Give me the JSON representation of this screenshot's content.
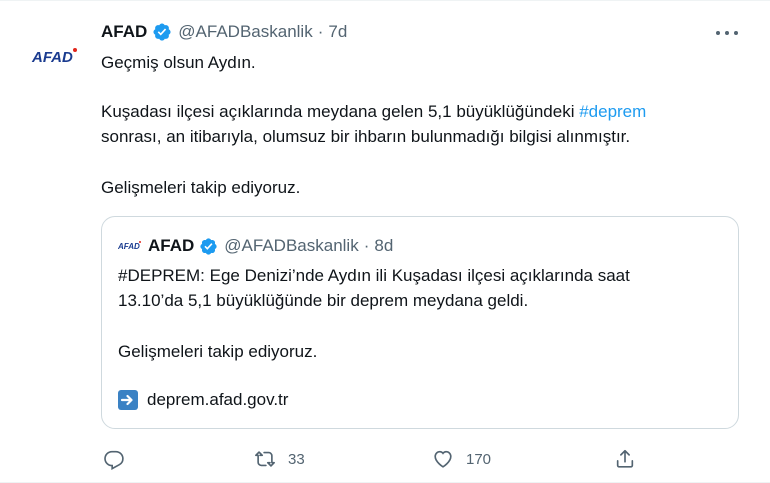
{
  "tweet": {
    "author_name": "AFAD",
    "handle": "@AFADBaskanlik",
    "separator": "·",
    "time": "7d",
    "avatar_logo": "AFAD",
    "lines": {
      "greeting": "Geçmiş olsun Aydın.",
      "line2_prefix": "Kuşadası ilçesi açıklarında meydana gelen 5,1 büyüklüğündeki ",
      "hashtag": "#deprem",
      "line3": "sonrası, an itibarıyla, olumsuz bir ihbarın bulunmadığı bilgisi alınmıştır.",
      "closing": "Gelişmeleri takip ediyoruz."
    }
  },
  "quote": {
    "author_name": "AFAD",
    "handle": "@AFADBaskanlik",
    "separator": "·",
    "time": "8d",
    "lines": {
      "line1": "#DEPREM: Ege Denizi’nde Aydın ili Kuşadası ilçesi açıklarında saat",
      "line2": "13.10’da 5,1 büyüklüğünde bir deprem meydana geldi.",
      "closing": "Gelişmeleri takip ediyoruz."
    },
    "link_text": "deprem.afad.gov.tr",
    "link_icon": "arrow-right-box-icon"
  },
  "actions": {
    "reply": {
      "icon": "reply-icon",
      "count": ""
    },
    "retweet": {
      "icon": "retweet-icon",
      "count": "33"
    },
    "like": {
      "icon": "heart-icon",
      "count": "170"
    },
    "share": {
      "icon": "share-icon",
      "count": ""
    }
  },
  "colors": {
    "text": "#0f1419",
    "secondary": "#536471",
    "link": "#1d9bf0",
    "border": "#cfd9de",
    "verified": "#1d9bf0",
    "brand_blue": "#1a3b8f",
    "brand_red": "#e1251b"
  }
}
